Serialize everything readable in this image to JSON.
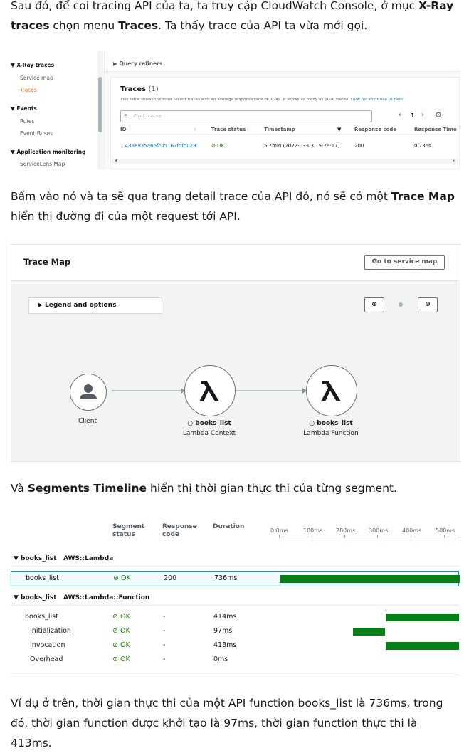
{
  "para1": {
    "prefix": "Sau đó, để coi tracing API của ta, ta truy cập CloudWatch Console, ở mục ",
    "bold1": "X-Ray traces",
    "mid": " chọn menu ",
    "bold2": "Traces",
    "suffix": ". Ta thấy trace của API ta vừa mới gọi."
  },
  "fig1": {
    "nav": {
      "xray": "▼ X-Ray traces",
      "service_map": "Service map",
      "traces": "Traces",
      "events": "▼ Events",
      "rules": "Rules",
      "event_buses": "Event Buses",
      "app_mon": "▼ Application monitoring",
      "servicelens": "ServiceLens Map"
    },
    "query_refiners": "▶ Query refiners",
    "title": "Traces",
    "count": "(1)",
    "desc": "This table shows the most recent traces with an average response time of 0.74s. It shows as many as 1000 traces.",
    "desc_link": "Look for any trace ID here.",
    "search_placeholder": "Find traces",
    "page": "1",
    "columns": {
      "id": "ID",
      "status": "Trace status",
      "timestamp": "Timestamp",
      "code": "Response code",
      "time": "Response Time"
    },
    "row": {
      "id": "...433e935a66fc05167fdfd029",
      "status": "OK",
      "timestamp": "5.7min (2022-03-03 15:26:17)",
      "code": "200",
      "time": "0.736s"
    }
  },
  "para2": {
    "prefix": "Bấm vào nó và ta sẽ qua trang detail trace của API đó, nó sẽ có một ",
    "bold": "Trace Map",
    "suffix": " hiển thị đường đi của một request tới API."
  },
  "fig2": {
    "title": "Trace Map",
    "go_button": "Go to service map",
    "legend": "▶ Legend and options",
    "nodes": [
      {
        "label": "Client",
        "sub": ""
      },
      {
        "label": "○ books_list",
        "sub": "Lambda Context"
      },
      {
        "label": "○ books_list",
        "sub": "Lambda Function"
      }
    ]
  },
  "para3": {
    "prefix": "Và ",
    "bold": "Segments Timeline",
    "suffix": " hiển thị thời gian thực thi của từng segment."
  },
  "fig3": {
    "columns": {
      "status": "Segment status",
      "code": "Response code",
      "duration": "Duration"
    },
    "ticks": [
      "0.0ms",
      "100ms",
      "200ms",
      "300ms",
      "400ms",
      "500ms"
    ],
    "group1": {
      "name": "▼ books_list",
      "type": "AWS::Lambda"
    },
    "group2": {
      "name": "▼ books_list",
      "type": "AWS::Lambda::Function"
    },
    "rows": [
      {
        "name": "books_list",
        "status": "OK",
        "code": "200",
        "duration": "736ms"
      },
      {
        "name": "books_list",
        "status": "OK",
        "code": "-",
        "duration": "414ms"
      },
      {
        "name": "Initialization",
        "status": "OK",
        "code": "-",
        "duration": "97ms"
      },
      {
        "name": "Invocation",
        "status": "OK",
        "code": "-",
        "duration": "413ms"
      },
      {
        "name": "Overhead",
        "status": "OK",
        "code": "-",
        "duration": "0ms"
      }
    ]
  },
  "para4": "Ví dụ ở trên, thời gian thực thi của một API function books_list là 736ms, trong đó, thời gian function được khởi tạo là 97ms, thời gian function thực thi là 413ms."
}
